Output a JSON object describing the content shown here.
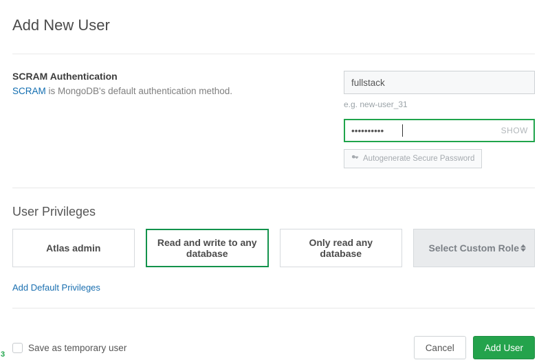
{
  "header": {
    "title": "Add New User"
  },
  "auth": {
    "title": "SCRAM Authentication",
    "link_text": "SCRAM",
    "desc_rest": " is MongoDB's default authentication method.",
    "username_value": "fullstack",
    "username_hint": "e.g. new-user_31",
    "password_value": "••••••••••",
    "show_label": "SHOW",
    "autogen_label": "Autogenerate Secure Password"
  },
  "privileges": {
    "title": "User Privileges",
    "cards": [
      {
        "label": "Atlas admin"
      },
      {
        "label": "Read and write to any database"
      },
      {
        "label": "Only read any database"
      },
      {
        "label": "Select Custom Role"
      }
    ],
    "add_default": "Add Default Privileges"
  },
  "footer": {
    "temp_label": "Save as temporary user",
    "cancel": "Cancel",
    "submit": "Add User"
  },
  "corner": "3"
}
